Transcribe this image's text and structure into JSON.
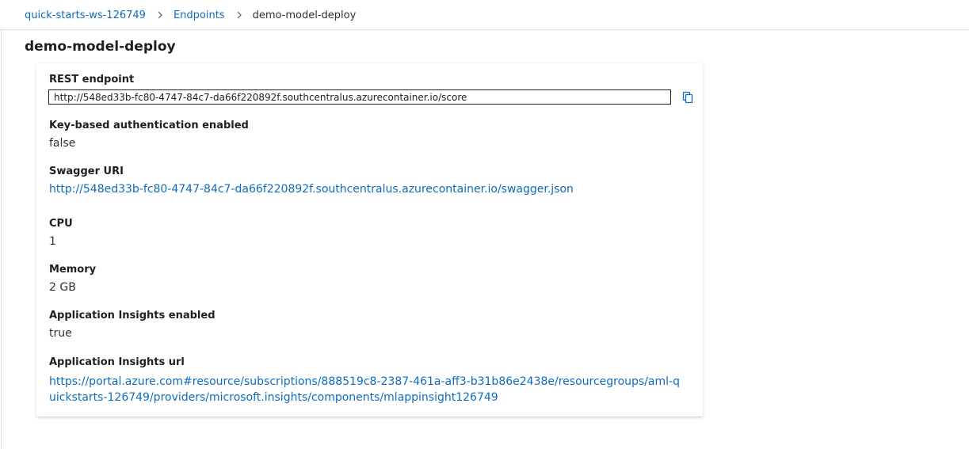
{
  "breadcrumb": {
    "workspace": "quick-starts-ws-126749",
    "endpoints": "Endpoints",
    "current": "demo-model-deploy"
  },
  "page_title": "demo-model-deploy",
  "details": {
    "rest_endpoint": {
      "label": "REST endpoint",
      "value": "http://548ed33b-fc80-4747-84c7-da66f220892f.southcentralus.azurecontainer.io/score"
    },
    "key_auth": {
      "label": "Key-based authentication enabled",
      "value": "false"
    },
    "swagger_uri": {
      "label": "Swagger URI",
      "value": "http://548ed33b-fc80-4747-84c7-da66f220892f.southcentralus.azurecontainer.io/swagger.json"
    },
    "cpu": {
      "label": "CPU",
      "value": "1"
    },
    "memory": {
      "label": "Memory",
      "value": "2 GB"
    },
    "app_insights_enabled": {
      "label": "Application Insights enabled",
      "value": "true"
    },
    "app_insights_url": {
      "label": "Application Insights url",
      "value": "https://portal.azure.com#resource/subscriptions/888519c8-2387-461a-aff3-b31b86e2438e/resourcegroups/aml-quickstarts-126749/providers/microsoft.insights/components/mlappinsight126749"
    }
  },
  "icons": {
    "copy": "copy-icon",
    "breadcrumb_separator": "chevron-right-icon"
  },
  "colors": {
    "link": "#0f6cbd",
    "text": "#1f1f1f",
    "divider": "#e1dfdd"
  }
}
